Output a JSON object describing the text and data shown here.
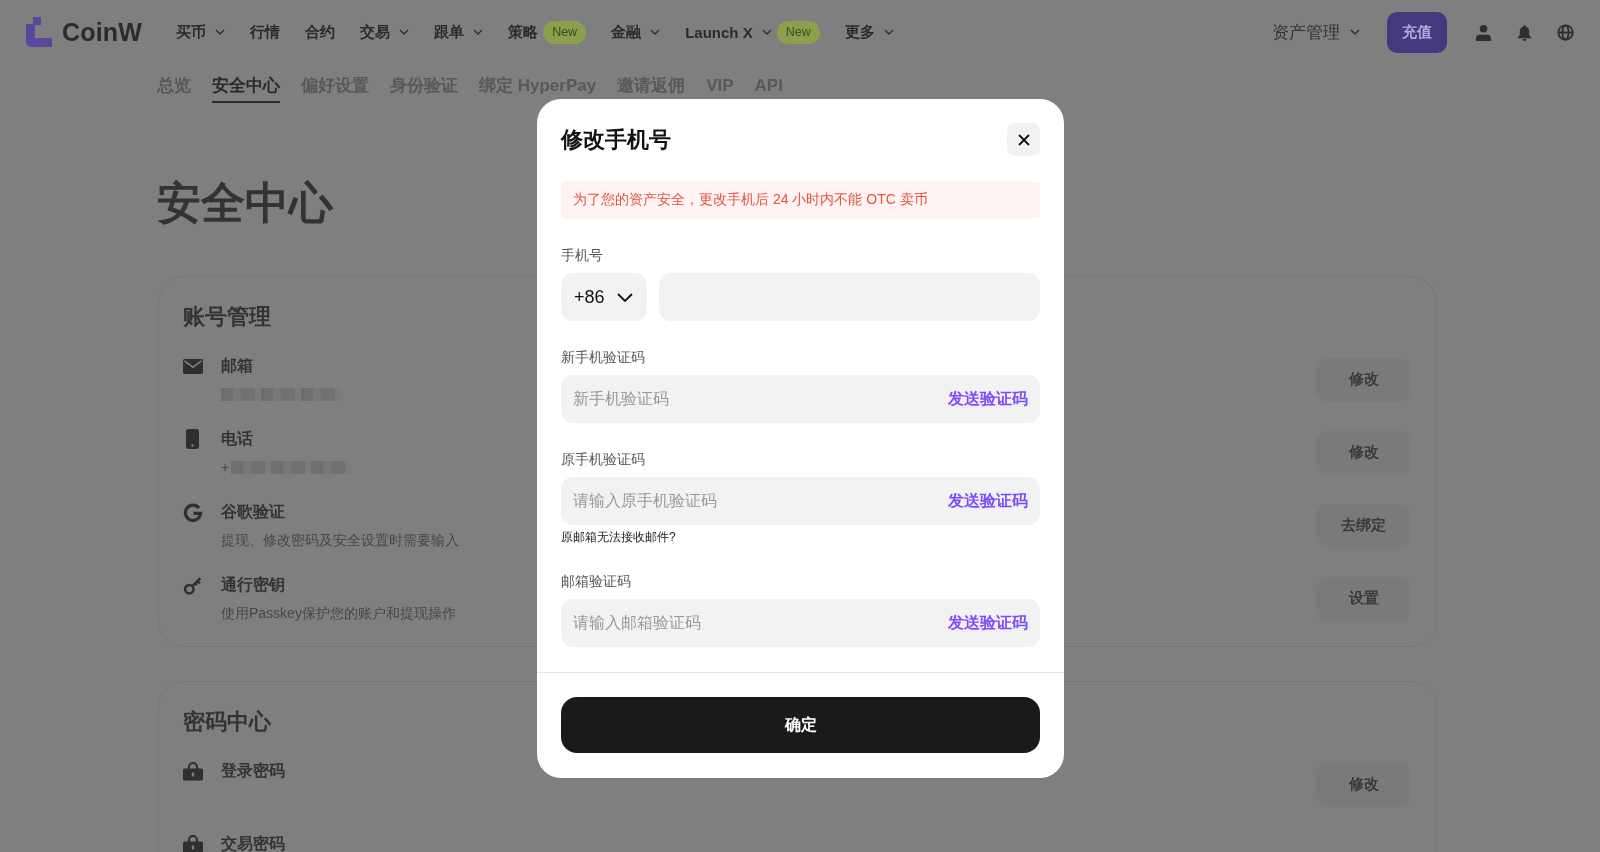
{
  "header": {
    "logo": "CoinW",
    "nav": [
      {
        "label": "买币",
        "dropdown": true
      },
      {
        "label": "行情",
        "dropdown": false
      },
      {
        "label": "合约",
        "dropdown": false
      },
      {
        "label": "交易",
        "dropdown": true
      },
      {
        "label": "跟单",
        "dropdown": true
      },
      {
        "label": "策略",
        "dropdown": false,
        "badge": "New"
      },
      {
        "label": "金融",
        "dropdown": true
      },
      {
        "label": "Launch X",
        "dropdown": true,
        "badge": "New"
      },
      {
        "label": "更多",
        "dropdown": true
      }
    ],
    "account_menu": {
      "label": "资产管理",
      "dropdown": true
    },
    "deposit_button": "充值"
  },
  "subnav": {
    "tabs": [
      {
        "label": "总览",
        "selected": false
      },
      {
        "label": "安全中心",
        "selected": true
      },
      {
        "label": "偏好设置",
        "selected": false
      },
      {
        "label": "身份验证",
        "selected": false
      },
      {
        "label": "绑定 HyperPay",
        "selected": false
      },
      {
        "label": "邀请返佣",
        "selected": false
      },
      {
        "label": "VIP",
        "selected": false
      },
      {
        "label": "API",
        "selected": false
      }
    ]
  },
  "page_title": "安全中心",
  "sections": [
    {
      "title": "账号管理",
      "items": [
        {
          "kind": "email",
          "label": "邮箱",
          "redacted": true,
          "button": "修改"
        },
        {
          "kind": "phone",
          "label": "电话",
          "value": "+",
          "redacted": true,
          "button": "修改"
        },
        {
          "kind": "google",
          "label": "谷歌验证",
          "redacted": false,
          "description": "提现、修改密码及安全设置时需要输入",
          "button": "去绑定"
        },
        {
          "kind": "passkey",
          "label": "通行密钥",
          "redacted": false,
          "description": "使用Passkey保护您的账户和提现操作",
          "button": "设置"
        }
      ]
    },
    {
      "title": "密码中心",
      "items": [
        {
          "kind": "password",
          "label": "登录密码",
          "redacted": false,
          "button": "修改"
        },
        {
          "kind": "password",
          "label": "交易密码",
          "redacted": false
        }
      ]
    }
  ],
  "modal": {
    "title": "修改手机号",
    "notice": "为了您的资产安全，更改手机后 24 小时内不能 OTC 卖币",
    "fields": [
      {
        "kind": "phone",
        "label": "手机号",
        "country_code": "+86"
      },
      {
        "kind": "code",
        "label": "新手机验证码",
        "placeholder": "新手机验证码",
        "action": "发送验证码"
      },
      {
        "kind": "code",
        "label": "原手机验证码",
        "placeholder": "请输入原手机验证码",
        "action": "发送验证码",
        "help": "原邮箱无法接收邮件?"
      },
      {
        "kind": "code",
        "label": "邮箱验证码",
        "placeholder": "请输入邮箱验证码",
        "action": "发送验证码"
      }
    ],
    "confirm_button": "确定"
  }
}
